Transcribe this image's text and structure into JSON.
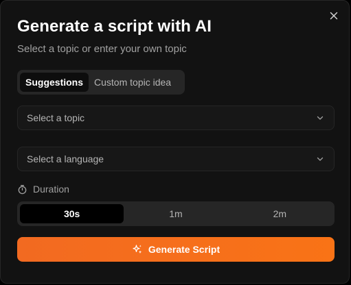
{
  "dialog": {
    "title": "Generate a script with AI",
    "subtitle": "Select a topic or enter your own topic",
    "close_icon": "close-icon"
  },
  "tabs": [
    {
      "label": "Suggestions",
      "active": true
    },
    {
      "label": "Custom topic idea",
      "active": false
    }
  ],
  "topic_select": {
    "placeholder": "Select a topic",
    "icon": "chevron-down-icon"
  },
  "language_select": {
    "placeholder": "Select a language",
    "icon": "chevron-down-icon"
  },
  "duration": {
    "label": "Duration",
    "icon": "stopwatch-icon",
    "options": [
      {
        "label": "30s",
        "active": true
      },
      {
        "label": "1m",
        "active": false
      },
      {
        "label": "2m",
        "active": false
      }
    ]
  },
  "generate_button": {
    "label": "Generate Script",
    "icon": "sparkles-icon"
  },
  "colors": {
    "accent": "#f97316",
    "background": "#121212",
    "surface": "#262626"
  }
}
